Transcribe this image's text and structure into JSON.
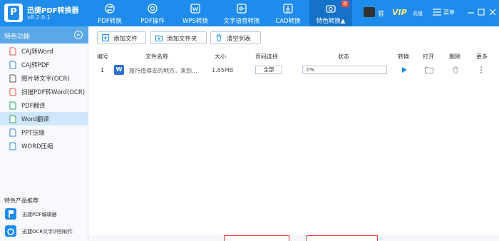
{
  "app": {
    "name": "迅捷PDF转换器",
    "version": "v8.2.0.1"
  },
  "nav": [
    {
      "label": "PDF转换",
      "icon": "swap-icon"
    },
    {
      "label": "PDF操作",
      "icon": "chat-icon"
    },
    {
      "label": "WPS转换",
      "icon": "wps-icon"
    },
    {
      "label": "文字语音转换",
      "icon": "waveform-icon"
    },
    {
      "label": "CAD转换",
      "icon": "cad-download-icon"
    },
    {
      "label": "特色转换▲",
      "icon": "camera-icon",
      "badge": "热",
      "active": true
    }
  ],
  "header_right": {
    "member": "官",
    "vip": "VIP",
    "vip_sub": "充值",
    "menu": "菜单"
  },
  "sidebar": {
    "title": "特色功能",
    "items": [
      {
        "label": "CAJ转Word"
      },
      {
        "label": "CAJ转PDF"
      },
      {
        "label": "图片转文字(OCR)"
      },
      {
        "label": "扫描PDF转Word(OCR)"
      },
      {
        "label": "PDF翻译"
      },
      {
        "label": "Word翻译",
        "active": true
      },
      {
        "label": "PPT压缩"
      },
      {
        "label": "WORD压缩"
      }
    ],
    "recommend_title": "特色产品推荐",
    "recommend": [
      {
        "label": "迅捷PDF编辑器"
      },
      {
        "label": "迅捷OCR文字识别软件"
      }
    ]
  },
  "toolbar": {
    "add_file": "添加文件",
    "add_folder": "添加文件夹",
    "clear_list": "清空列表"
  },
  "table": {
    "headers": [
      "编号",
      "文件名称",
      "大小",
      "页码选择",
      "状态",
      "转换",
      "打开",
      "删除",
      "更多"
    ],
    "rows": [
      {
        "index": "1",
        "file_icon": "W",
        "name": "旅行值得去的地方，来到...",
        "size": "1.85MB",
        "pages": "全部",
        "progress_pct": 0,
        "status": "0%"
      }
    ]
  },
  "colors": {
    "brand": "#1f8ceb",
    "sidebar_header": "#5ba8e8",
    "active_row": "#cfe6fb",
    "hot_badge": "#ff4a3d"
  }
}
